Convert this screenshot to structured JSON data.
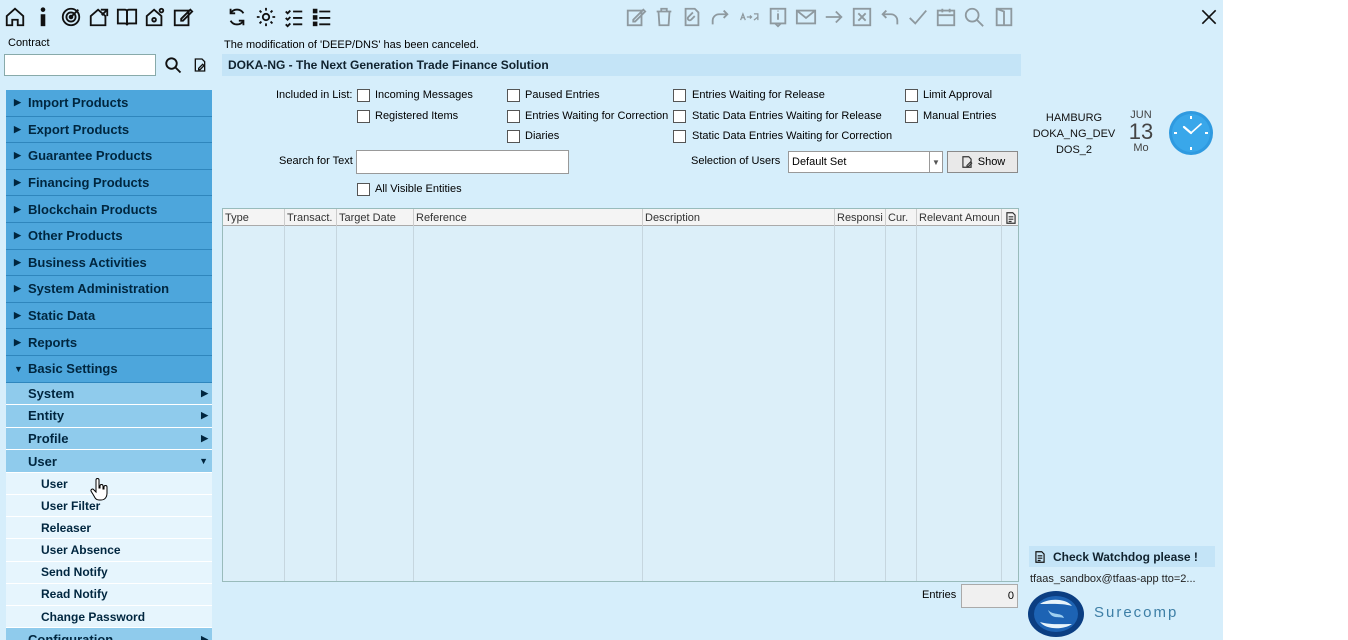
{
  "toolbar": {
    "left_icons": [
      "home-icon",
      "info-icon",
      "target-icon",
      "house-share-icon",
      "book-icon",
      "network-icon",
      "edit-icon",
      "refresh-icon",
      "gear-icon",
      "checklist-icon",
      "list-icon"
    ],
    "right_icons": [
      "edit-sign-icon",
      "trash-icon",
      "attach-doc-icon",
      "forward-icon",
      "translate-icon",
      "info-doc-icon",
      "mail-icon",
      "arrow-right-icon",
      "cancel-box-icon",
      "undo-icon",
      "check-icon",
      "calendar-icon",
      "search-icon",
      "exit-door-icon"
    ],
    "close_icon": "close-icon"
  },
  "sidebar": {
    "contract_label": "Contract",
    "contract_value": "",
    "menu": [
      {
        "label": "Import Products",
        "expanded": false
      },
      {
        "label": "Export Products",
        "expanded": false
      },
      {
        "label": "Guarantee Products",
        "expanded": false
      },
      {
        "label": "Financing Products",
        "expanded": false
      },
      {
        "label": "Blockchain Products",
        "expanded": false
      },
      {
        "label": "Other Products",
        "expanded": false
      },
      {
        "label": "Business Activities",
        "expanded": false
      },
      {
        "label": "System Administration",
        "expanded": false
      },
      {
        "label": "Static Data",
        "expanded": false
      },
      {
        "label": "Reports",
        "expanded": false
      },
      {
        "label": "Basic Settings",
        "expanded": true
      }
    ],
    "submenu": [
      {
        "label": "System"
      },
      {
        "label": "Entity"
      },
      {
        "label": "Profile"
      },
      {
        "label": "User"
      }
    ],
    "leaves": [
      "User",
      "User Filter",
      "Releaser",
      "User Absence",
      "Send Notify",
      "Read Notify",
      "Change Password"
    ],
    "after_leaves": {
      "label": "Configuration"
    }
  },
  "main": {
    "status_message": "The modification of 'DEEP/DNS' has been canceled.",
    "title": "DOKA-NG - The Next Generation Trade Finance Solution",
    "included_label": "Included in List:",
    "checkboxes": {
      "incoming": "Incoming Messages",
      "registered": "Registered Items",
      "paused": "Paused Entries",
      "waiting_correction": "Entries Waiting for Correction",
      "diaries": "Diaries",
      "waiting_release": "Entries Waiting for Release",
      "static_release": "Static Data Entries Waiting for Release",
      "static_correction": "Static Data Entries Waiting for Correction",
      "limit_approval": "Limit Approval",
      "manual_entries": "Manual Entries",
      "all_visible": "All Visible Entities"
    },
    "search_label": "Search for Text",
    "search_value": "",
    "users_label": "Selection of Users",
    "users_value": "Default Set",
    "show_button": "Show",
    "columns": [
      "Type",
      "Transact.",
      "Target Date",
      "Reference",
      "Description",
      "Responsi",
      "Cur.",
      "Relevant Amoun"
    ],
    "entries_label": "Entries",
    "entries_value": "0"
  },
  "info": {
    "location": "HAMBURG",
    "system": "DOKA_NG_DEV",
    "instance": "DOS_2",
    "month": "JUN",
    "day": "13",
    "weekday": "Mo",
    "watchdog": "Check Watchdog please !",
    "user_email": "tfaas_sandbox@tfaas-app tto=2...",
    "brand": "Surecomp"
  }
}
